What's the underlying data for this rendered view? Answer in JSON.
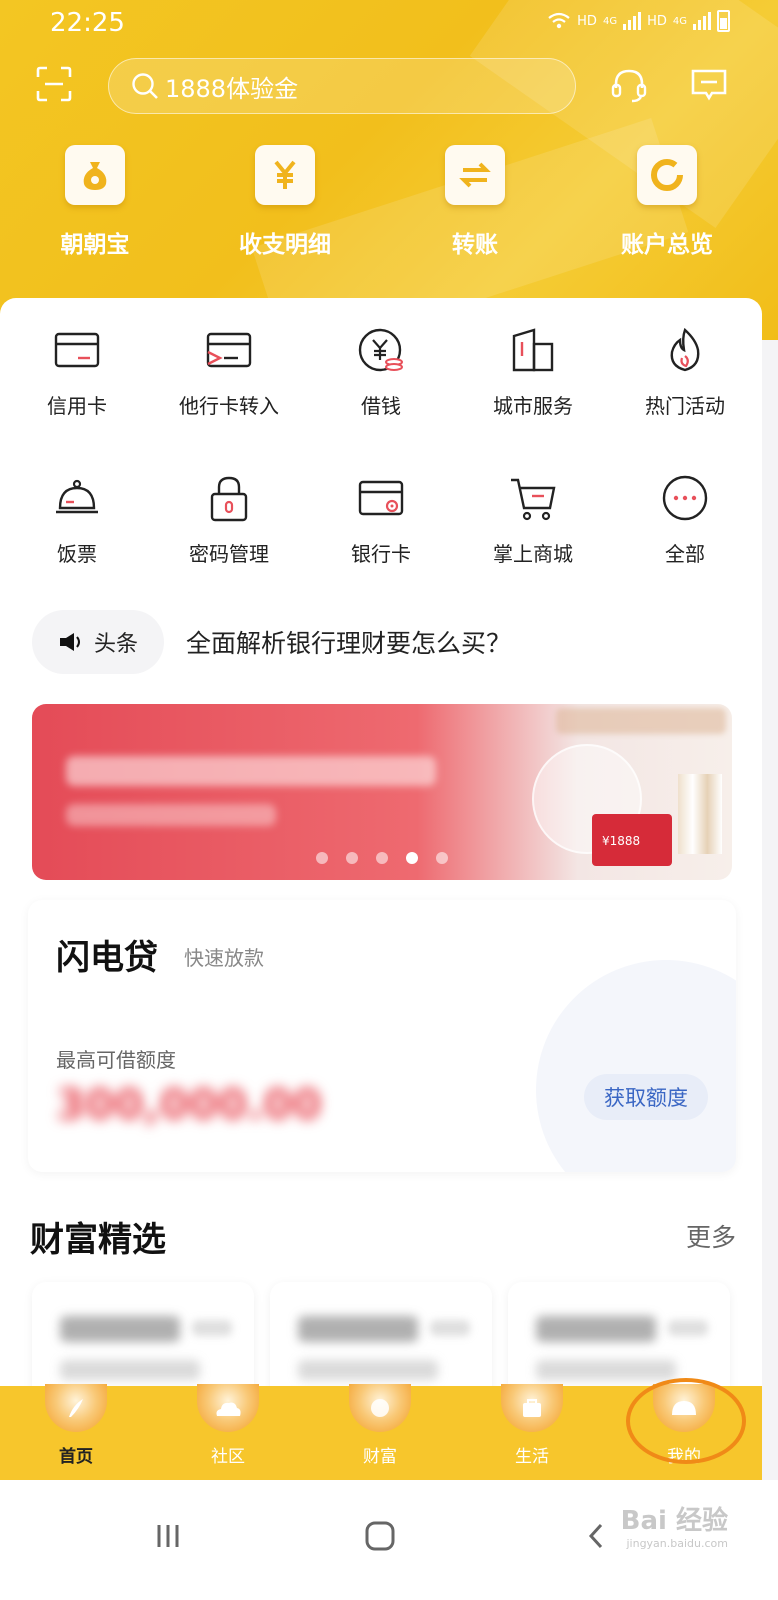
{
  "status_bar": {
    "time": "22:25",
    "network_1": "HD",
    "network_1_gen": "4G",
    "network_2": "HD",
    "network_2_gen": "4G"
  },
  "header": {
    "search_placeholder": "1888体验金"
  },
  "quick_actions": [
    {
      "label": "朝朝宝",
      "icon": "money-bag-icon"
    },
    {
      "label": "收支明细",
      "icon": "yuan-icon"
    },
    {
      "label": "转账",
      "icon": "transfer-icon"
    },
    {
      "label": "账户总览",
      "icon": "pie-ring-icon"
    }
  ],
  "services": [
    {
      "label": "信用卡",
      "icon": "credit-card-icon"
    },
    {
      "label": "他行卡转入",
      "icon": "card-transfer-icon"
    },
    {
      "label": "借钱",
      "icon": "yuan-coin-icon"
    },
    {
      "label": "城市服务",
      "icon": "building-icon"
    },
    {
      "label": "热门活动",
      "icon": "flame-icon"
    },
    {
      "label": "饭票",
      "icon": "cloche-icon"
    },
    {
      "label": "密码管理",
      "icon": "lock-icon"
    },
    {
      "label": "银行卡",
      "icon": "bank-card-icon"
    },
    {
      "label": "掌上商城",
      "icon": "cart-icon"
    },
    {
      "label": "全部",
      "icon": "more-dots-icon"
    }
  ],
  "news": {
    "tag": "头条",
    "headline": "全面解析银行理财要怎么买？"
  },
  "banner": {
    "envelope_text": "¥1888",
    "page_count": 5,
    "active_page": 4
  },
  "loan": {
    "title": "闪电贷",
    "subtitle": "快速放款",
    "limit_label": "最高可借额度",
    "amount": "300,000.00",
    "button": "获取额度"
  },
  "wealth": {
    "title": "财富精选",
    "more": "更多"
  },
  "tabs": [
    {
      "label": "首页",
      "active": true
    },
    {
      "label": "社区",
      "active": false
    },
    {
      "label": "财富",
      "active": false
    },
    {
      "label": "生活",
      "active": false
    },
    {
      "label": "我的",
      "active": false
    }
  ],
  "watermark": {
    "brand": "Bai 经验",
    "url": "jingyan.baidu.com"
  },
  "colors": {
    "brand_yellow": "#f2c21e",
    "accent_red": "#e8505a",
    "highlight_ring": "#f08a17"
  }
}
